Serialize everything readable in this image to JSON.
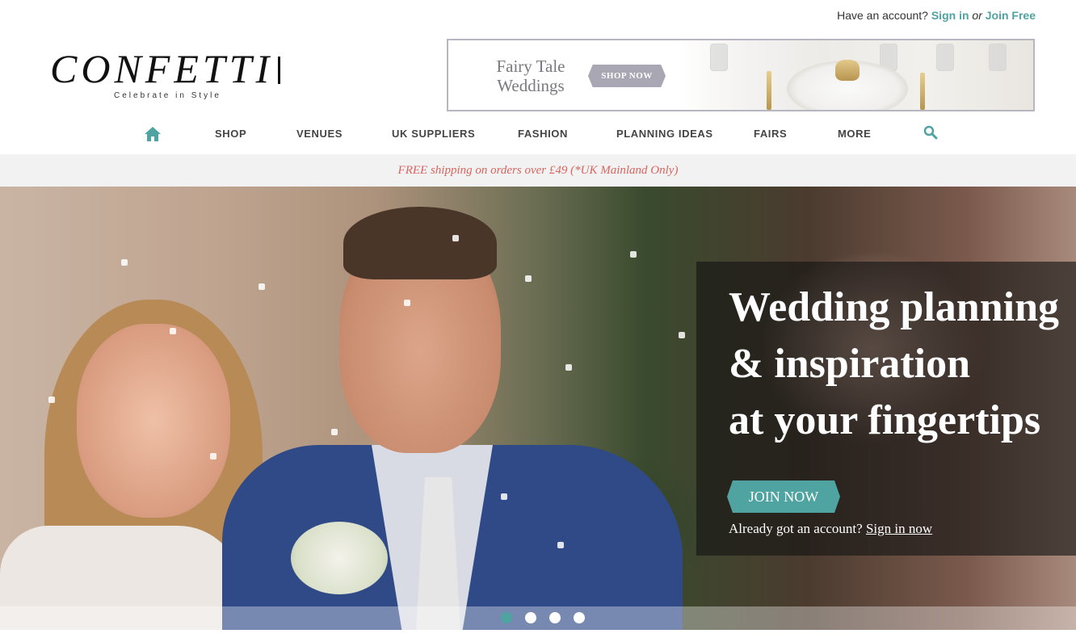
{
  "account": {
    "prompt": "Have an account?",
    "sign_in": "Sign in",
    "or": "or",
    "join": "Join Free"
  },
  "logo": {
    "word": "CONFETTI",
    "tagline": "Celebrate in Style"
  },
  "ad": {
    "title_line1": "Fairy Tale",
    "title_line2": "Weddings",
    "button": "SHOP NOW"
  },
  "nav": {
    "home_icon": "home-icon",
    "items": [
      "SHOP",
      "VENUES",
      "UK SUPPLIERS",
      "FASHION",
      "PLANNING IDEAS",
      "FAIRS",
      "MORE"
    ],
    "search_icon": "search-icon"
  },
  "shipping": {
    "text": "FREE shipping on orders over £49 (*UK Mainland Only)"
  },
  "hero": {
    "headline_line1": "Wedding planning",
    "headline_line2": "& inspiration",
    "headline_line3": "at your fingertips",
    "join_button": "JOIN NOW",
    "signin_prompt": "Already got an account?",
    "signin_link": "Sign in now",
    "slides_total": 4,
    "active_slide": 1
  },
  "colors": {
    "accent": "#4fa3a0",
    "shipping_text": "#d9645e",
    "ad_button": "#a9a7b3"
  }
}
